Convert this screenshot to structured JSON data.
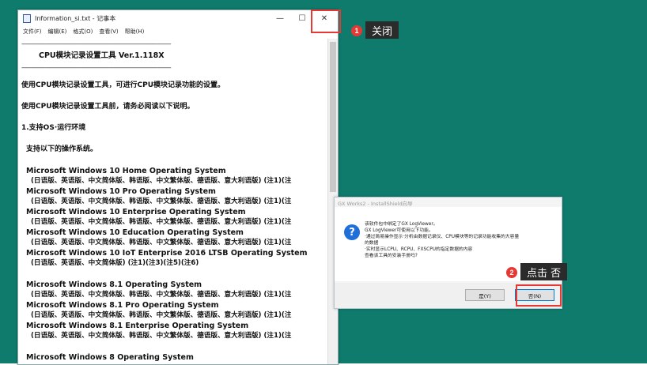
{
  "notepad": {
    "title": "Information_si.txt - 记事本",
    "controls": {
      "minimize": "—",
      "maximize": "☐",
      "close": "✕"
    },
    "menu": [
      "文件(F)",
      "编辑(E)",
      "格式(O)",
      "查看(V)",
      "帮助(H)"
    ],
    "dashes": "----------------------------------------------------------------------------------------------------",
    "doc_title": "CPU模块记录设置工具            Ver.1.118X",
    "para1": "使用CPU模块记录设置工具，可进行CPU模块记录功能的设置。",
    "para2": "使用CPU模块记录设置工具前，请务必阅读以下说明。",
    "section": "1.支持OS·运行环境",
    "section_sub": " 支持以下的操作系统。",
    "os_list": [
      {
        "name": "Microsoft Windows 10 Home Operating System",
        "langs": "(日语版、英语版、中文简体版、韩语版、中文繁体版、德语版、意大利语版) (注1)(注"
      },
      {
        "name": "Microsoft Windows 10 Pro Operating System",
        "langs": "(日语版、英语版、中文简体版、韩语版、中文繁体版、德语版、意大利语版) (注1)(注"
      },
      {
        "name": "Microsoft Windows 10 Enterprise Operating System",
        "langs": "(日语版、英语版、中文简体版、韩语版、中文繁体版、德语版、意大利语版) (注1)(注"
      },
      {
        "name": "Microsoft Windows 10 Education Operating System",
        "langs": "(日语版、英语版、中文简体版、韩语版、中文繁体版、德语版、意大利语版) (注1)(注"
      },
      {
        "name": "Microsoft Windows 10 IoT Enterprise 2016 LTSB Operating System",
        "langs": "(日语版、英语版、中文简体版) (注1)(注3)(注5)(注6)"
      }
    ],
    "os_list2": [
      {
        "name": "Microsoft Windows 8.1 Operating System",
        "langs": "(日语版、英语版、中文简体版、韩语版、中文繁体版、德语版、意大利语版) (注1)(注"
      },
      {
        "name": "Microsoft Windows 8.1 Pro Operating System",
        "langs": "(日语版、英语版、中文简体版、韩语版、中文繁体版、德语版、意大利语版) (注1)(注"
      },
      {
        "name": "Microsoft Windows 8.1 Enterprise Operating System",
        "langs": "(日语版、英语版、中文简体版、韩语版、中文繁体版、德语版、意大利语版) (注1)(注"
      }
    ],
    "os_last": "Microsoft Windows 8 Operating System"
  },
  "callout1": {
    "number": "1",
    "label": "关闭"
  },
  "callout2": {
    "number": "2",
    "label": "点击 否"
  },
  "dialog": {
    "title": "GX Works2 - InstallShield向导",
    "icon": "?",
    "lines": [
      "该软件包中绑定了GX LogViewer。",
      "GX LogViewer可使用以下功能。",
      "·通过简易操作显示·分析由数据记录仪、CPU模块等的记录功能收集的大容量",
      " 的数据",
      "·实时显示LCPU、RCPU、FXSCPU的指定数据的内容",
      "查看该工具的安装手册吗?"
    ],
    "yes_label": "是(Y)",
    "no_label": "否(N)"
  },
  "colors": {
    "desktop": "#0f7b6c",
    "highlight": "#e53935",
    "callout_bg": "#2b2b2b"
  }
}
